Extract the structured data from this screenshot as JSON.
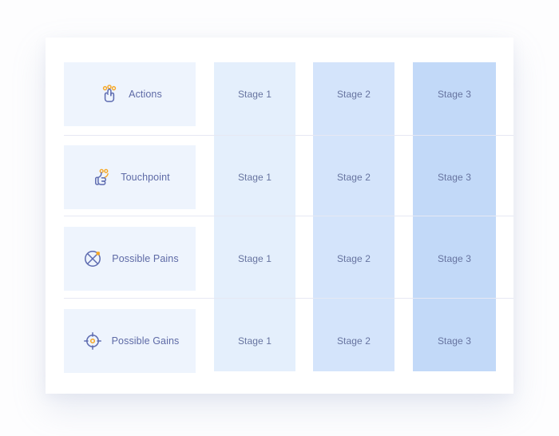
{
  "canvas": {
    "background": "#fdfdfe",
    "card_background": "#ffffff"
  },
  "colors": {
    "label_cell": "#eef4fd",
    "stage1": "#e4effc",
    "stage2": "#d4e4fb",
    "stage3": "#c2d9f8",
    "divider": "#e6e8f3",
    "label_text": "#5e6aa6",
    "stage_text": "#66739f",
    "icon_stroke": "#5d6bb0",
    "icon_accent": "#f6a623"
  },
  "rows": [
    {
      "id": "actions",
      "label": "Actions",
      "icon": "tap-hand-icon",
      "cells": [
        {
          "stage": "stage-1",
          "label": "Stage 1"
        },
        {
          "stage": "stage-2",
          "label": "Stage 2"
        },
        {
          "stage": "stage-3",
          "label": "Stage 3"
        }
      ]
    },
    {
      "id": "touchpoint",
      "label": "Touchpoint",
      "icon": "thumbs-up-icon",
      "cells": [
        {
          "stage": "stage-1",
          "label": "Stage 1"
        },
        {
          "stage": "stage-2",
          "label": "Stage 2"
        },
        {
          "stage": "stage-3",
          "label": "Stage 3"
        }
      ]
    },
    {
      "id": "possible-pains",
      "label": "Possible Pains",
      "icon": "circle-cross-icon",
      "cells": [
        {
          "stage": "stage-1",
          "label": "Stage 1"
        },
        {
          "stage": "stage-2",
          "label": "Stage 2"
        },
        {
          "stage": "stage-3",
          "label": "Stage 3"
        }
      ]
    },
    {
      "id": "possible-gains",
      "label": "Possible Gains",
      "icon": "target-crosshair-icon",
      "cells": [
        {
          "stage": "stage-1",
          "label": "Stage 1"
        },
        {
          "stage": "stage-2",
          "label": "Stage 2"
        },
        {
          "stage": "stage-3",
          "label": "Stage 3"
        }
      ]
    }
  ],
  "columns": [
    {
      "id": "stage-1",
      "label": "Stage 1",
      "color": "#e4effc"
    },
    {
      "id": "stage-2",
      "label": "Stage 2",
      "color": "#d4e4fb"
    },
    {
      "id": "stage-3",
      "label": "Stage 3",
      "color": "#c2d9f8"
    }
  ]
}
